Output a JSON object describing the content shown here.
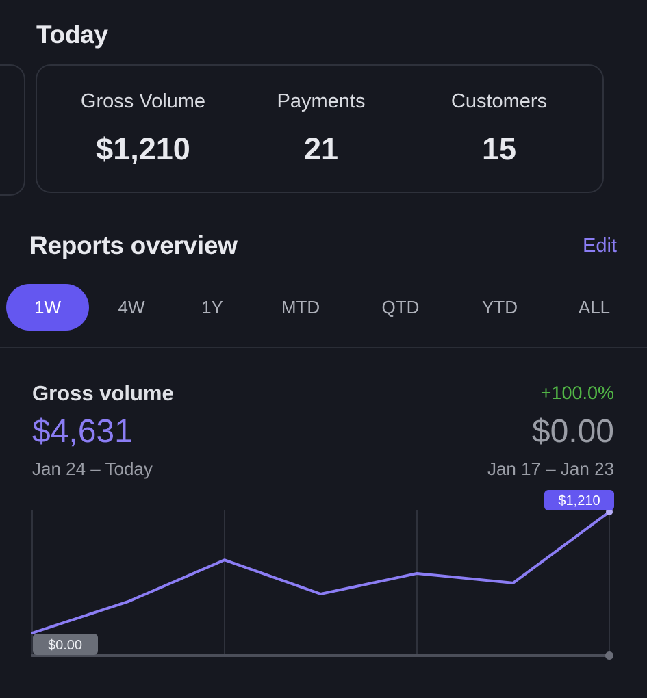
{
  "today": {
    "title": "Today",
    "stats": [
      {
        "label": "Gross Volume",
        "value": "$1,210"
      },
      {
        "label": "Payments",
        "value": "21"
      },
      {
        "label": "Customers",
        "value": "15"
      }
    ]
  },
  "reports": {
    "title": "Reports overview",
    "edit_label": "Edit",
    "ranges": [
      "1W",
      "4W",
      "1Y",
      "MTD",
      "QTD",
      "YTD",
      "ALL"
    ],
    "active_range": "1W"
  },
  "gross_volume": {
    "label": "Gross volume",
    "value": "$4,631",
    "range": "Jan 24 – Today",
    "compare_change": "+100.0%",
    "compare_value": "$0.00",
    "compare_range": "Jan 17 – Jan 23"
  },
  "colors": {
    "accent": "#8b7df4",
    "active_tab": "#6457f0",
    "positive": "#52b646",
    "background": "#161820"
  },
  "chart_data": {
    "type": "line",
    "series": [
      {
        "values": [
          0,
          315,
          730,
          390,
          595,
          500,
          1210
        ]
      }
    ],
    "start_label": "$0.00",
    "end_label": "$1,210",
    "ylim": [
      0,
      1210
    ]
  }
}
